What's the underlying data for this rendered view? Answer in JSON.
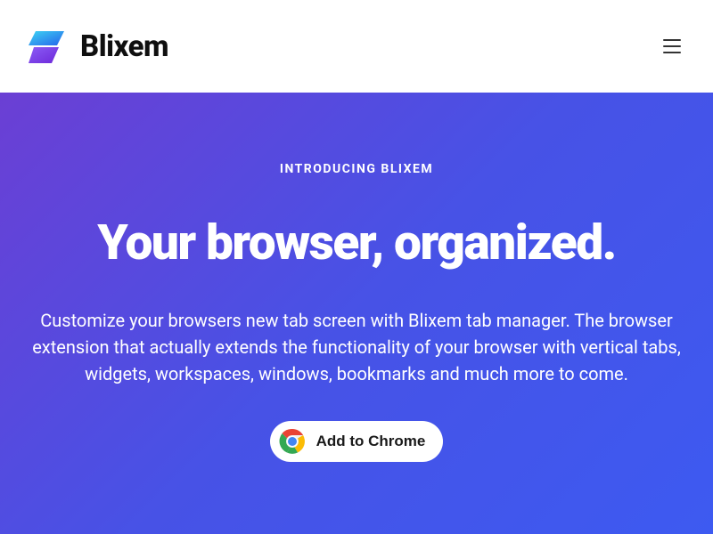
{
  "header": {
    "brand_name": "Blixem"
  },
  "hero": {
    "tagline": "INTRODUCING BLIXEM",
    "headline": "Your browser, organized.",
    "description": "Customize your browsers new tab screen with Blixem tab manager. The browser extension that actually extends the functionality of your browser with vertical tabs, widgets, workspaces, windows, bookmarks and much more to come.",
    "cta_label": "Add to Chrome"
  },
  "colors": {
    "gradient_start": "#6b3fd4",
    "gradient_mid": "#4752e6",
    "gradient_end": "#3d5af1",
    "brand_cyan": "#3dd5f3",
    "brand_purple": "#6f42c1"
  }
}
